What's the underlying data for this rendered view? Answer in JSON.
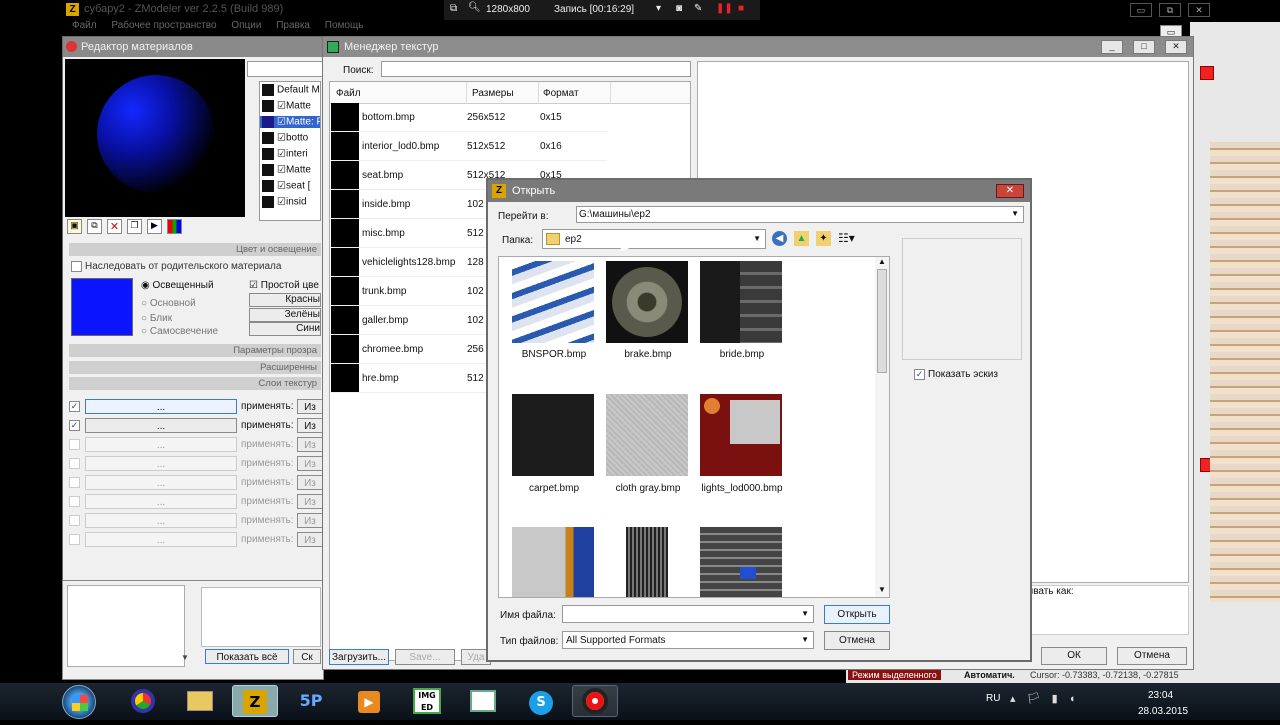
{
  "app": {
    "title": "субару2 - ZModeler ver 2.2.5 (Build 989)",
    "menu": [
      "Файл",
      "Рабочее пространство",
      "Опции",
      "Правка",
      "Помощь"
    ]
  },
  "recorder": {
    "resolution": "1280x800",
    "status": "Запись [00:16:29]"
  },
  "material_editor": {
    "title": "Редактор материалов",
    "materials": [
      "Default M",
      "Matte",
      "Matte: F",
      "botto",
      "interi",
      "Matte",
      "seat [",
      "insid"
    ],
    "sections": {
      "color_lighting": "Цвет и освещение",
      "inherit": "Наследовать от родительского материала",
      "lit": "Освещенный",
      "simple_color": "Простой цве",
      "base": "Основной",
      "glare": "Блик",
      "glow": "Самосвечение",
      "red": "Красны",
      "green": "Зелёны",
      "blue": "Сини",
      "transparency": "Параметры прозра",
      "extended": "Расширенны",
      "layers": "Слои текстур"
    },
    "layer_rows": [
      {
        "btn": "...",
        "apply": "применять:",
        "mode": "Из"
      },
      {
        "btn": "...",
        "apply": "применять:",
        "mode": "Из"
      },
      {
        "btn": "...",
        "apply": "применять:",
        "mode": "Из"
      },
      {
        "btn": "...",
        "apply": "применять:",
        "mode": "Из"
      },
      {
        "btn": "...",
        "apply": "применять:",
        "mode": "Из"
      },
      {
        "btn": "...",
        "apply": "применять:",
        "mode": "Из"
      },
      {
        "btn": "...",
        "apply": "применять:",
        "mode": "Из"
      },
      {
        "btn": "...",
        "apply": "применять:",
        "mode": "Из"
      }
    ],
    "show_all": "Показать всё",
    "show_short": "Ск",
    "swatch_color": "#0a14ff"
  },
  "texture_manager": {
    "title": "Менеджер текстур",
    "search_label": "Поиск:",
    "columns": [
      "Файл",
      "Размеры",
      "Формат"
    ],
    "rows": [
      {
        "file": "bottom.bmp",
        "size": "256x512",
        "fmt": "0x15"
      },
      {
        "file": "interior_lod0.bmp",
        "size": "512x512",
        "fmt": "0x16"
      },
      {
        "file": "seat.bmp",
        "size": "512x512",
        "fmt": "0x15"
      },
      {
        "file": "inside.bmp",
        "size": "102",
        "fmt": ""
      },
      {
        "file": "misc.bmp",
        "size": "512",
        "fmt": ""
      },
      {
        "file": "vehiclelights128.bmp",
        "size": "128",
        "fmt": ""
      },
      {
        "file": "trunk.bmp",
        "size": "102",
        "fmt": ""
      },
      {
        "file": "galler.bmp",
        "size": "102",
        "fmt": ""
      },
      {
        "file": "chromee.bmp",
        "size": "256",
        "fmt": ""
      },
      {
        "file": "hre.bmp",
        "size": "512",
        "fmt": ""
      }
    ],
    "load": "Загрузить...",
    "save": "Save...",
    "delete": "Уда",
    "save_as": "ывать как:",
    "ok": "ОК",
    "cancel": "Отмена"
  },
  "open_dialog": {
    "title": "Открыть",
    "goto_label": "Перейти в:",
    "goto_path": "G:\\машины\\ep2",
    "folder_label": "Папка:",
    "folder": "ep2",
    "files": [
      "BNSPOR.bmp",
      "brake.bmp",
      "bride.bmp",
      "carpet.bmp",
      "cloth gray.bmp",
      "lights_lod000.bmp"
    ],
    "show_preview": "Показать эскиз",
    "filename_label": "Имя файла:",
    "filename": "",
    "filetype_label": "Тип файлов:",
    "filetype": "All Supported Formats",
    "open_btn": "Открыть",
    "cancel_btn": "Отмена"
  },
  "status": {
    "mode": "Режим выделенного",
    "auto": "Автоматич.",
    "cursor": "Cursor: -0.73383, -0.72138, -0.27815"
  },
  "taskbar": {
    "lang": "RU",
    "time": "23:04",
    "date": "28.03.2015"
  }
}
